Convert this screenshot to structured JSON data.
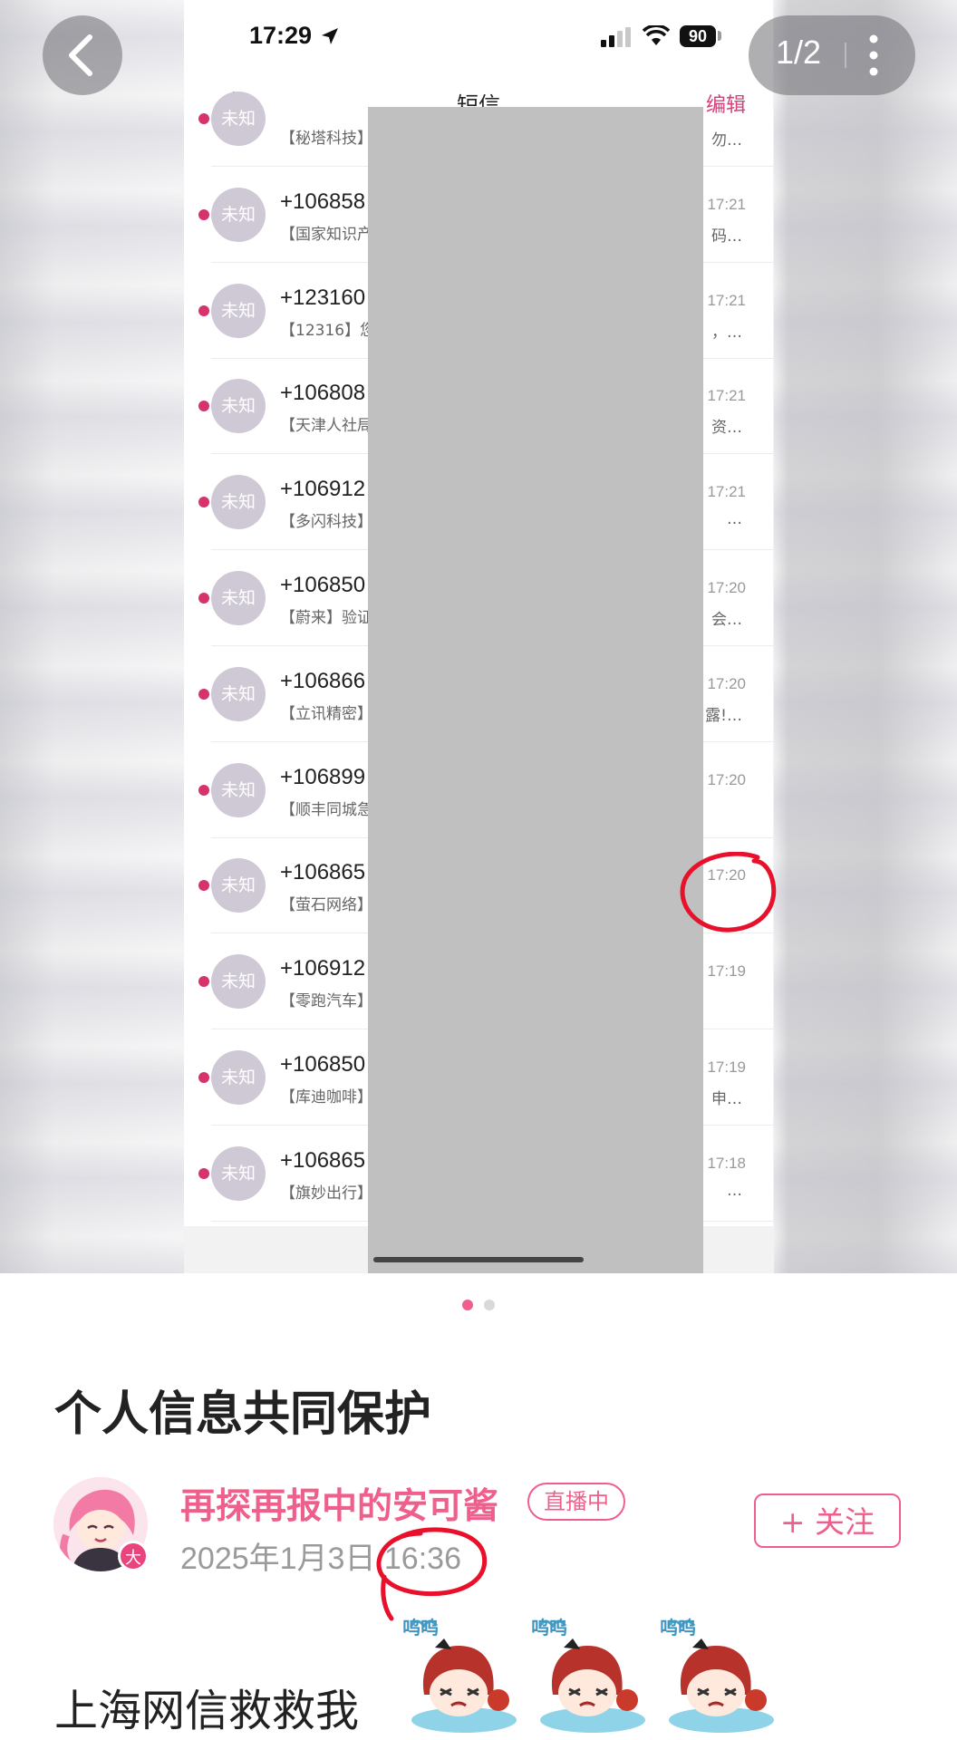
{
  "viewer": {
    "page_counter": "1/2",
    "back_icon": "chevron-left-icon",
    "more_icon": "more-vertical-icon"
  },
  "screenshot": {
    "status_bar": {
      "time": "17:29",
      "battery": "90"
    },
    "navbar": {
      "title": "短信",
      "edit": "编辑"
    },
    "messages": [
      {
        "avatar": "未知",
        "sender": "",
        "preview": "【秘塔科技】",
        "time": "",
        "tail": "勿…"
      },
      {
        "avatar": "未知",
        "sender": "+106858",
        "preview": "【国家知识产",
        "time": "17:21",
        "tail": "码…"
      },
      {
        "avatar": "未知",
        "sender": "+123160",
        "preview": "【12316】您",
        "time": "17:21",
        "tail": "，…"
      },
      {
        "avatar": "未知",
        "sender": "+106808",
        "preview": "【天津人社局",
        "time": "17:21",
        "tail": "资…"
      },
      {
        "avatar": "未知",
        "sender": "+106912",
        "preview": "【多闪科技】",
        "time": "17:21",
        "tail": "…"
      },
      {
        "avatar": "未知",
        "sender": "+106850",
        "preview": "【蔚来】验证",
        "time": "17:20",
        "tail": "会…"
      },
      {
        "avatar": "未知",
        "sender": "+106866",
        "preview": "【立讯精密】",
        "time": "17:20",
        "tail": "露!…"
      },
      {
        "avatar": "未知",
        "sender": "+106899",
        "preview": "【顺丰同城急",
        "time": "17:20",
        "tail": ""
      },
      {
        "avatar": "未知",
        "sender": "+106865",
        "preview": "【萤石网络】",
        "time": "17:20",
        "tail": ""
      },
      {
        "avatar": "未知",
        "sender": "+106912",
        "preview": "【零跑汽车】",
        "time": "17:19",
        "tail": ""
      },
      {
        "avatar": "未知",
        "sender": "+106850",
        "preview": "【库迪咖啡】",
        "time": "17:19",
        "tail": "申…"
      },
      {
        "avatar": "未知",
        "sender": "+106865",
        "preview": "【旗妙出行】",
        "time": "17:18",
        "tail": "…"
      }
    ],
    "redaction_color": "#c0c0c0"
  },
  "pager": {
    "count": 2,
    "active": 0,
    "active_color": "#ef5f8c",
    "inactive_color": "#d9d9d9"
  },
  "post": {
    "title": "个人信息共同保护",
    "author": {
      "name": "再探再报中的安可酱",
      "live_badge": "直播中",
      "avatar_badge": "大",
      "date": "2025年1月3日 16:36"
    },
    "follow_button": "+ 关注",
    "body": "上海网信救救我",
    "stickers": [
      "crying-anime-girl-sticker",
      "crying-anime-girl-sticker",
      "crying-anime-girl-sticker"
    ],
    "sticker_caption": "呜呜"
  },
  "colors": {
    "accent": "#ef5f8c",
    "annotation": "#e8102a"
  }
}
